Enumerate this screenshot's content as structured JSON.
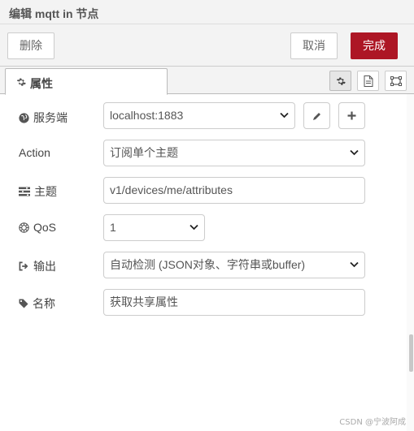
{
  "title": "编辑 mqtt in 节点",
  "buttons": {
    "delete": "删除",
    "cancel": "取消",
    "done": "完成"
  },
  "tabs": {
    "properties": "属性",
    "icons": [
      "gear-icon",
      "document-icon",
      "frame-icon"
    ]
  },
  "form": {
    "server": {
      "label": "服务端",
      "value": "localhost:1883"
    },
    "action": {
      "label": "Action",
      "value": "订阅单个主题"
    },
    "topic": {
      "label": "主题",
      "value": "v1/devices/me/attributes"
    },
    "qos": {
      "label": "QoS",
      "value": "1"
    },
    "output": {
      "label": "输出",
      "value": "自动检测 (JSON对象、字符串或buffer)"
    },
    "name": {
      "label": "名称",
      "value": "获取共享属性"
    }
  },
  "watermark": "CSDN @宁波阿成",
  "colors": {
    "primary_button": "#ad1625",
    "header_bg": "#f3f3f3",
    "border": "#cccccc"
  }
}
